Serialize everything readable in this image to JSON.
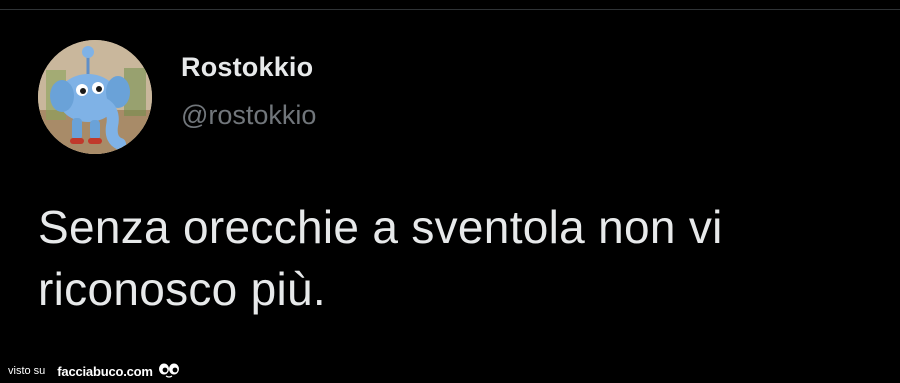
{
  "tweet": {
    "display_name": "Rostokkio",
    "handle": "@rostokkio",
    "text": "Senza orecchie a sventola non vi riconosco più."
  },
  "avatar": {
    "icon": "cartoon-elephant-avatar",
    "colors": {
      "background": "#c9b79c",
      "character": "#7fb2e6"
    }
  },
  "watermark": {
    "prefix": "visto su",
    "site": "facciabuco.com",
    "icon": "eyes-icon"
  },
  "colors": {
    "background": "#000000",
    "text_primary": "#e7e9ea",
    "text_secondary": "#71767b",
    "divider": "#2f3336"
  }
}
